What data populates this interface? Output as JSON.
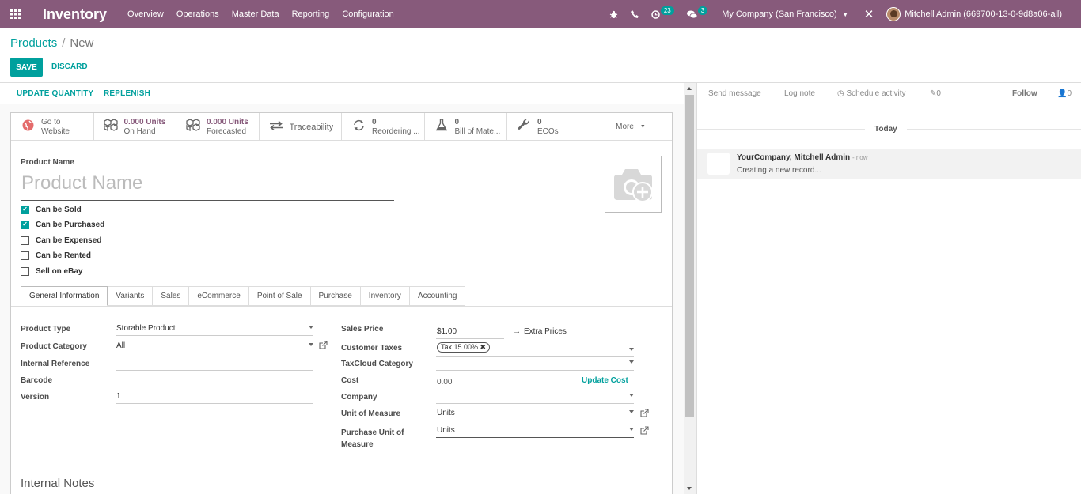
{
  "navbar": {
    "app_title": "Inventory",
    "menu": [
      "Overview",
      "Operations",
      "Master Data",
      "Reporting",
      "Configuration"
    ],
    "activity_count": "23",
    "message_count": "3",
    "company": "My Company (San Francisco)",
    "user": "Mitchell Admin (669700-13-0-9d8a06-all)"
  },
  "breadcrumb": {
    "parent": "Products",
    "separator": "/",
    "current": "New"
  },
  "buttons": {
    "save": "SAVE",
    "discard": "DISCARD"
  },
  "statusbar": {
    "update_quantity": "UPDATE QUANTITY",
    "replenish": "REPLENISH"
  },
  "smart_buttons": [
    {
      "num": "",
      "label1": "Go to",
      "label2": "Website",
      "icon": "globe-icon"
    },
    {
      "num": "0.000 Units",
      "label2": "On Hand",
      "icon": "cubes-icon"
    },
    {
      "num": "0.000 Units",
      "label2": "Forecasted",
      "icon": "cubes-icon"
    },
    {
      "num": "",
      "label1": "Traceability",
      "label2": "",
      "icon": "exchange-icon"
    },
    {
      "num": "0",
      "label2": "Reordering ...",
      "icon": "refresh-icon"
    },
    {
      "num": "0",
      "label2": "Bill of Mate...",
      "icon": "flask-icon"
    },
    {
      "num": "0",
      "label2": "ECOs",
      "icon": "wrench-icon"
    }
  ],
  "more": "More",
  "product": {
    "name_label": "Product Name",
    "name_placeholder": "Product Name"
  },
  "checkboxes": [
    {
      "label": "Can be Sold",
      "checked": true
    },
    {
      "label": "Can be Purchased",
      "checked": true
    },
    {
      "label": "Can be Expensed",
      "checked": false
    },
    {
      "label": "Can be Rented",
      "checked": false
    },
    {
      "label": "Sell on eBay",
      "checked": false
    }
  ],
  "tabs": [
    "General Information",
    "Variants",
    "Sales",
    "eCommerce",
    "Point of Sale",
    "Purchase",
    "Inventory",
    "Accounting"
  ],
  "general": {
    "product_type_label": "Product Type",
    "product_type": "Storable Product",
    "product_category_label": "Product Category",
    "product_category": "All",
    "internal_reference_label": "Internal Reference",
    "internal_reference": "",
    "barcode_label": "Barcode",
    "barcode": "",
    "version_label": "Version",
    "version": "1",
    "sales_price_label": "Sales Price",
    "sales_price": "$1.00",
    "extra_prices": "Extra Prices",
    "customer_taxes_label": "Customer Taxes",
    "customer_taxes_tag": "Tax 15.00%",
    "taxcloud_label": "TaxCloud Category",
    "taxcloud": "",
    "cost_label": "Cost",
    "cost": "0.00",
    "update_cost": "Update Cost",
    "company_label": "Company",
    "company": "",
    "uom_label": "Unit of Measure",
    "uom": "Units",
    "purchase_uom_label1": "Purchase Unit of",
    "purchase_uom_label2": "Measure",
    "purchase_uom": "Units"
  },
  "internal_notes_title": "Internal Notes",
  "chatter": {
    "send_message": "Send message",
    "log_note": "Log note",
    "schedule_activity": "Schedule activity",
    "attachments": "0",
    "follow": "Follow",
    "followers": "0",
    "today": "Today",
    "message_author": "YourCompany, Mitchell Admin",
    "message_date": "- now",
    "message_body": "Creating a new record..."
  },
  "colors": {
    "brand": "#875a7b",
    "accent": "#00a09d"
  }
}
